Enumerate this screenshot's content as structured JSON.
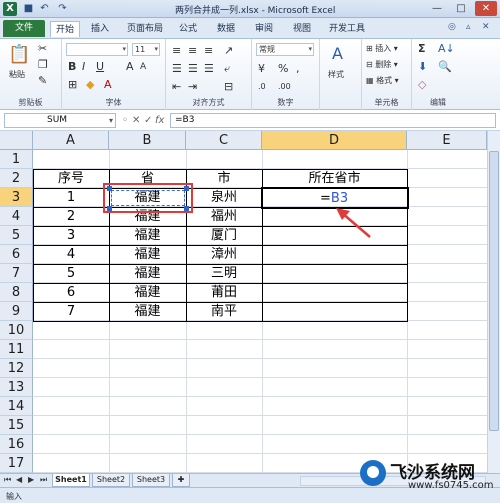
{
  "window": {
    "title": "两列合并成一列.xlsx - Microsoft Excel",
    "app_icon": "X",
    "controls": {
      "minimize": "—",
      "maximize": "□",
      "close": "✕"
    }
  },
  "quick_access": {
    "save": "💾",
    "undo": "↶",
    "redo": "↷"
  },
  "ribbon": {
    "file_tab": "文件",
    "tabs": [
      "开始",
      "插入",
      "页面布局",
      "公式",
      "数据",
      "审阅",
      "视图",
      "开发工具"
    ],
    "active_tab": "开始",
    "groups": {
      "clipboard": {
        "label": "剪贴板",
        "paste": "粘贴"
      },
      "font": {
        "label": "字体",
        "font_size": "11",
        "bold": "B",
        "italic": "I",
        "underline": "U"
      },
      "alignment": {
        "label": "对齐方式"
      },
      "number": {
        "label": "数字",
        "format": "常规",
        "percent": "%",
        "comma": ","
      },
      "styles": {
        "label": "样式"
      },
      "cells": {
        "label": "单元格",
        "insert": "插入",
        "delete": "删除",
        "format": "格式"
      },
      "editing": {
        "label": "编辑",
        "sum": "Σ"
      }
    }
  },
  "formula_bar": {
    "name_box": "SUM",
    "cancel": "✕",
    "enter": "✓",
    "fx": "fx",
    "content": "=B3"
  },
  "grid": {
    "columns": [
      "A",
      "B",
      "C",
      "D",
      "E"
    ],
    "selected_column": "D",
    "rows": [
      "1",
      "2",
      "3",
      "4",
      "5",
      "6",
      "7",
      "8",
      "9",
      "10",
      "11",
      "12",
      "13",
      "14",
      "15",
      "16",
      "17"
    ],
    "selected_row": "3",
    "headers": {
      "A": "序号",
      "B": "省",
      "C": "市",
      "D": "所在省市"
    },
    "data": [
      {
        "A": "1",
        "B": "福建",
        "C": "泉州"
      },
      {
        "A": "2",
        "B": "福建",
        "C": "福州"
      },
      {
        "A": "3",
        "B": "福建",
        "C": "厦门"
      },
      {
        "A": "4",
        "B": "福建",
        "C": "漳州"
      },
      {
        "A": "5",
        "B": "福建",
        "C": "三明"
      },
      {
        "A": "6",
        "B": "福建",
        "C": "莆田"
      },
      {
        "A": "7",
        "B": "福建",
        "C": "南平"
      }
    ],
    "editing_cell": {
      "prefix": "=",
      "ref": "B3"
    }
  },
  "sheets": [
    "Sheet1",
    "Sheet2",
    "Sheet3"
  ],
  "active_sheet": "Sheet1",
  "status": {
    "mode": "输入"
  },
  "watermark": {
    "title": "飞沙系统网",
    "url": "www.fs0745.com"
  },
  "colors": {
    "accent_file": "#2c7a3d",
    "reference": "#2f55d4",
    "annotation": "#e13a3a",
    "selected_header": "#f9d27c"
  }
}
